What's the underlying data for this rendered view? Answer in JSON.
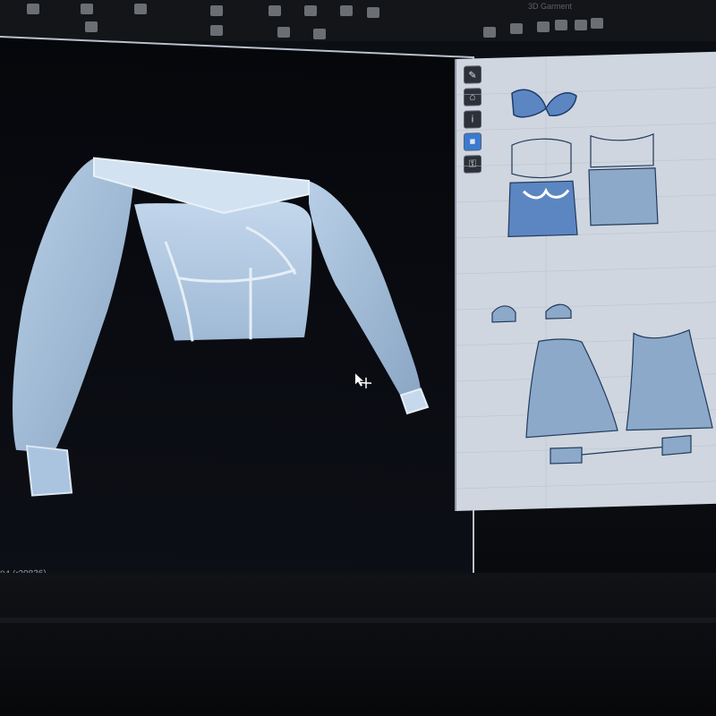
{
  "app": {
    "window_title": "3D Garment",
    "right_label": "Garment"
  },
  "toolbar": {
    "icons": [
      "move-icon",
      "rotate-icon",
      "pin-icon",
      "select-icon",
      "brush-icon",
      "fold-icon",
      "sewing-icon",
      "avatar-icon",
      "cloth-icon",
      "arrange-icon",
      "measure-icon",
      "wind-icon"
    ]
  },
  "viewport": {
    "garment": "off-shoulder corset blouse with puffed sleeves",
    "cursor": "move-cursor-icon"
  },
  "status": {
    "text": "04 (r29836)"
  },
  "pattern_window": {
    "tools": [
      "pen-icon",
      "fold-icon",
      "info-icon",
      "fabric-icon",
      "lock-icon"
    ],
    "active_tool": 3
  },
  "colors": {
    "accent": "#2f8fe0",
    "garment": "#a9c4df",
    "pattern_fill": "#8ca9c9",
    "panel_bg": "#cfd6df"
  }
}
